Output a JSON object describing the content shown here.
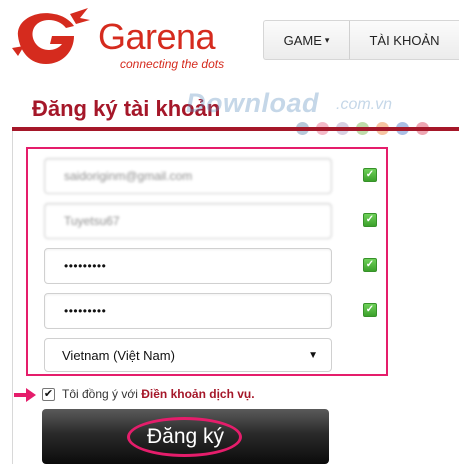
{
  "header": {
    "logo_name": "Garena",
    "logo_tagline": "connecting the dots",
    "nav": [
      {
        "label": "GAME",
        "caret": "▾"
      },
      {
        "label": "TÀI KHOẢN"
      }
    ]
  },
  "page_title": "Đăng ký tài khoản",
  "watermark": {
    "text": "Download",
    "suffix": ".com.vn",
    "dot_colors": [
      "#9fb7ce",
      "#f0a3b5",
      "#c9c0d8",
      "#a9d08e",
      "#f4b183",
      "#8faadc",
      "#e88a9a"
    ]
  },
  "form": {
    "email_value": "saidoriginm@gmail.com",
    "username_value": "Tuyetsu67",
    "password_value": "•••••••••",
    "confirm_password_value": "•••••••••",
    "valid_check": "✓",
    "country_selected": "Vietnam (Việt Nam)",
    "country_arrow": "▼"
  },
  "terms": {
    "checkbox_mark": "✔",
    "text_prefix": "Tôi đồng ý với ",
    "link_text": "Điền khoản dịch vụ."
  },
  "submit_label": "Đăng ký",
  "colors": {
    "brand_red": "#d52b1e",
    "title_maroon": "#a51729",
    "highlight_pink": "#e51d6b",
    "valid_green": "#3ca12b"
  }
}
